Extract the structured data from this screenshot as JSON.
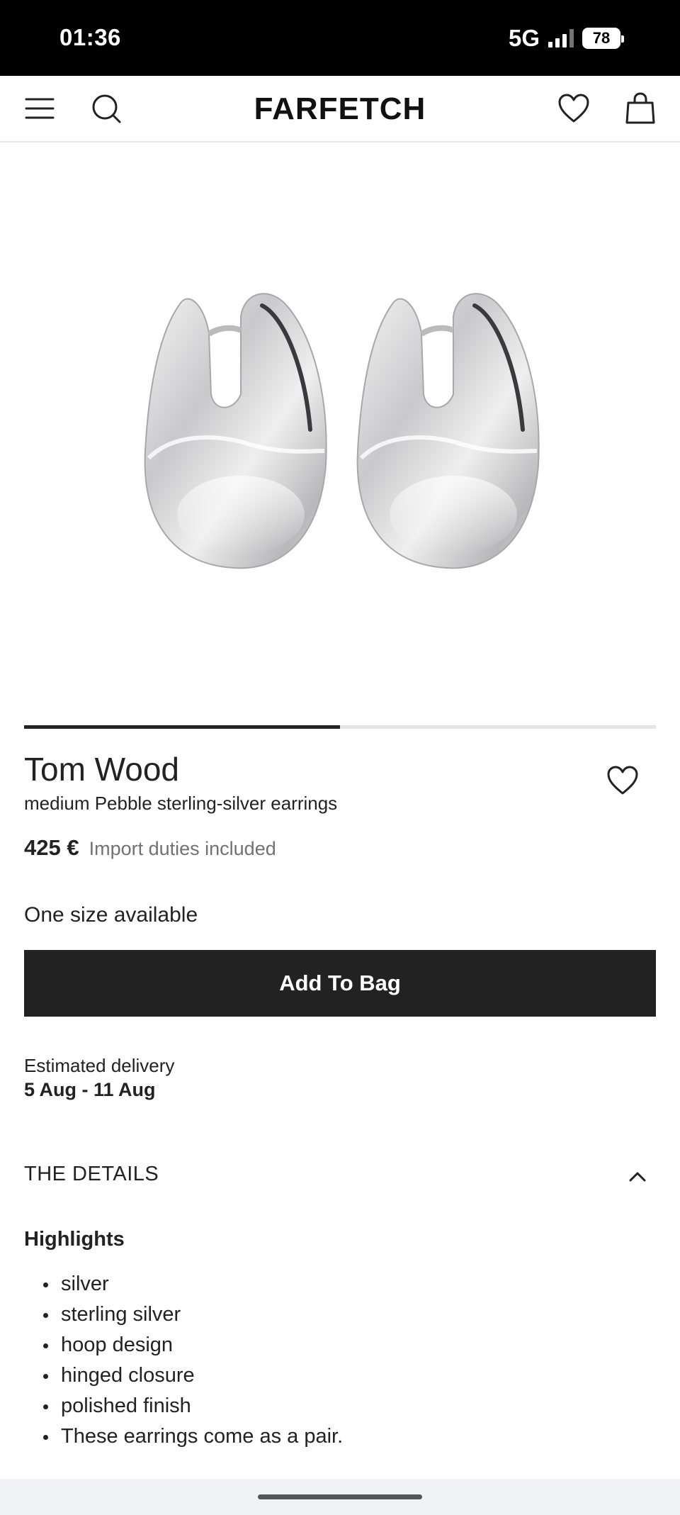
{
  "status_bar": {
    "time": "01:36",
    "network": "5G",
    "battery": "78"
  },
  "nav": {
    "logo": "FARFETCH"
  },
  "product": {
    "brand": "Tom Wood",
    "name": "medium Pebble sterling-silver earrings",
    "price": "425 €",
    "duties_note": "Import duties included",
    "image_progress": 0.5,
    "size_availability": "One size available",
    "add_to_bag_label": "Add To Bag"
  },
  "delivery": {
    "label": "Estimated delivery",
    "dates": "5 Aug - 11 Aug"
  },
  "details": {
    "title": "THE DETAILS",
    "highlights_title": "Highlights",
    "highlights": [
      "silver",
      "sterling silver",
      "hoop design",
      "hinged closure",
      "polished finish",
      "These earrings come as a pair."
    ]
  }
}
